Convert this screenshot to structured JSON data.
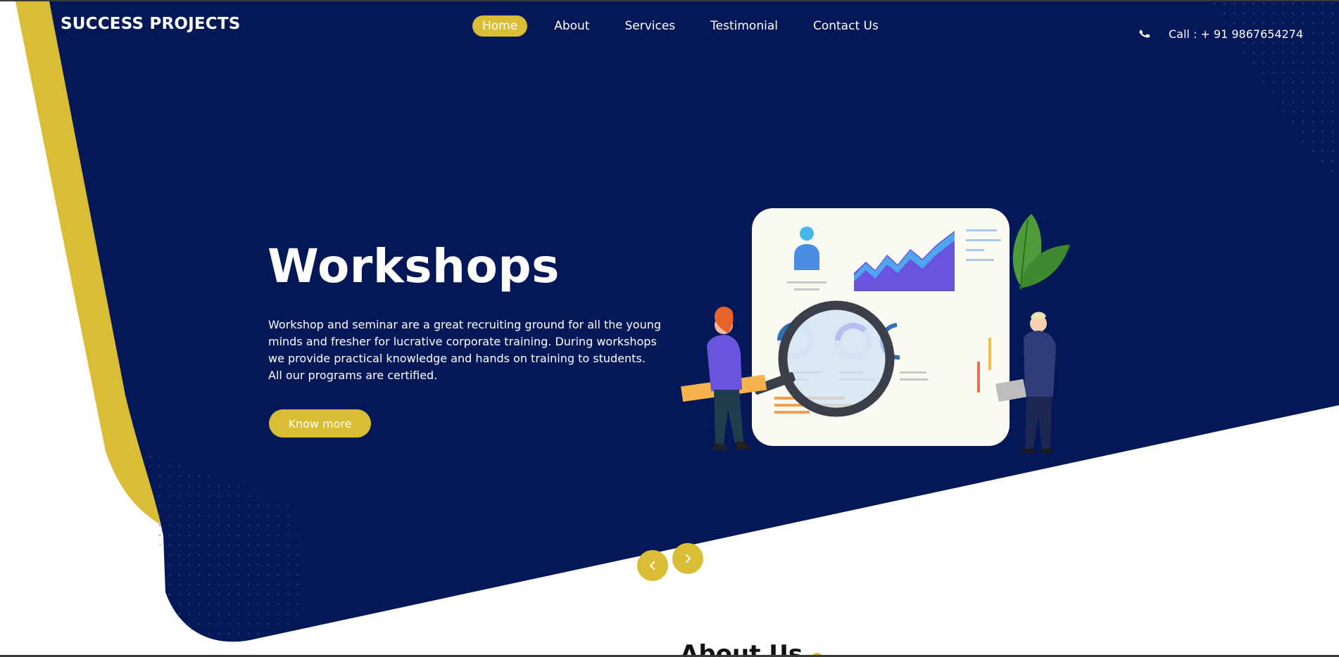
{
  "brand": {
    "name": "SUCCESS PROJECTS"
  },
  "nav": {
    "items": [
      {
        "label": "Home",
        "active": true
      },
      {
        "label": "About"
      },
      {
        "label": "Services"
      },
      {
        "label": "Testimonial"
      },
      {
        "label": "Contact Us"
      }
    ]
  },
  "contact": {
    "call_text": "Call : + 91 9867654274",
    "icon": "phone-icon"
  },
  "hero": {
    "title": "Workshops",
    "description": "Workshop and seminar are a great recruiting ground for all the young minds and fresher for lucrative corporate training. During workshops we provide practical knowledge and hands on training to students. All our programs are certified.",
    "button_label": "Know more"
  },
  "slider": {
    "prev_icon": "chevron-left-icon",
    "next_icon": "chevron-right-icon"
  },
  "about": {
    "heading": "About Us"
  },
  "colors": {
    "navy": "#041857",
    "accent": "#d9bd35",
    "white": "#ffffff"
  }
}
